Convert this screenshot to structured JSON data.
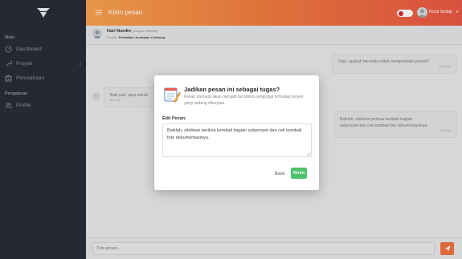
{
  "header": {
    "title": "Kirim pesan",
    "user_name": "Rizqi Setiaji",
    "user_caret": "∨"
  },
  "sidebar": {
    "section_main": "Main",
    "items": [
      {
        "label": "Dashboard"
      },
      {
        "label": "Proyek"
      },
      {
        "label": "Perusahaan"
      }
    ],
    "section_settings": "Pengaturan",
    "settings_items": [
      {
        "label": "Profile"
      }
    ],
    "chevron": "›"
  },
  "chat": {
    "contact_name": "Hari Nurdin",
    "contact_role": "(penjual material)",
    "project_label": "Proyek:",
    "project_name": "Perbaikan Jembatan Cirahong"
  },
  "messages": [
    {
      "text": "Halo, apakah bersedia untuk memperbaiki proyek?",
      "time": "05.50 am"
    },
    {
      "text": "Baik pak, saya sekali",
      "time": "5.4n am"
    },
    {
      "text_line1": "Baiklah, silahkan periksa kembali bagian",
      "text_line2": "subproyek dan cek kembali foto dokumentasinya.",
      "time": "6:40 am"
    }
  ],
  "input": {
    "placeholder": "Tulis pesan..."
  },
  "modal": {
    "title": "Jadikan pesan ini sebagai tugas?",
    "desc": "Pesan otomatis akan menjadi list status pengingat terhadap proyek yang sedang dikerjaan.",
    "edit_label": "Edit Pesan:",
    "edit_value": "Baiklah, silahkan periksa kembali bagian subproyek dan cek kembali foto dokumentasinya.",
    "cancel_label": "Batal",
    "send_label": "Kirim"
  },
  "colors": {
    "accent": "#ec6f3c",
    "sidebar_bg": "#252a33",
    "confirm": "#4fc36a",
    "toggle_dot": "#d8282a"
  }
}
